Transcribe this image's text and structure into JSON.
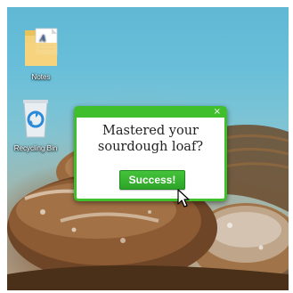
{
  "desktop": {
    "icons": [
      {
        "label": "Notes",
        "icon": "notes-file-icon"
      },
      {
        "label": "Recycling Bin",
        "icon": "recycling-bin-icon"
      }
    ],
    "wallpaper": "bread-loaves-in-basket"
  },
  "popup": {
    "message_line1": "Mastered your",
    "message_line2": "sourdough loaf?",
    "button_label": "Success!",
    "close_symbol": "×",
    "accent_color": "#3fbf2c"
  },
  "cursor": {
    "icon": "arrow-pointer-icon"
  }
}
